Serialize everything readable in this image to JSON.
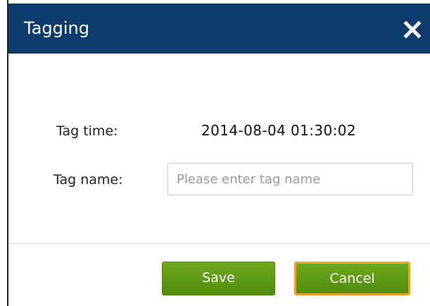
{
  "dialog": {
    "title": "Tagging",
    "colors": {
      "titlebar": "#0d3b6b",
      "button_green": "#5e9b14",
      "cancel_focus_border": "#f0a12a"
    },
    "close_icon": "close-icon"
  },
  "form": {
    "tag_time_label": "Tag time:",
    "tag_time_value": "2014-08-04 01:30:02",
    "tag_name_label": "Tag name:",
    "tag_name_value": "",
    "tag_name_placeholder": "Please enter tag name"
  },
  "buttons": {
    "save_label": "Save",
    "cancel_label": "Cancel"
  }
}
